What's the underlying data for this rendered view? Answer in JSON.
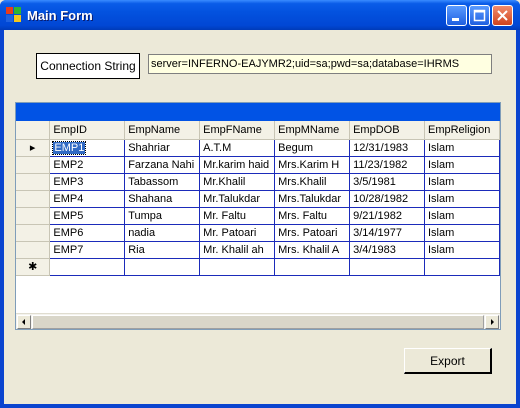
{
  "window": {
    "title": "Main Form",
    "colors": {
      "titlebar": "#0352df",
      "caption_bar": "#0153e5",
      "grid_line": "#1b2bba",
      "selection": "#316ac5"
    }
  },
  "toolbar": {
    "connection_label": "Connection String",
    "connection_value": "server=INFERNO-EAJYMR2;uid=sa;pwd=sa;database=IHRMS",
    "export_label": "Export"
  },
  "grid": {
    "columns": [
      "EmpID",
      "EmpName",
      "EmpFName",
      "EmpMName",
      "EmpDOB",
      "EmpReligion"
    ],
    "rows": [
      [
        "EMP1",
        "Shahriar",
        "A.T.M",
        "Begum",
        "12/31/1983",
        "Islam"
      ],
      [
        "EMP2",
        "Farzana Nahi",
        "Mr.karim haid",
        "Mrs.Karim H",
        "11/23/1982",
        "Islam"
      ],
      [
        "EMP3",
        "Tabassom",
        "Mr.Khalil",
        "Mrs.Khalil",
        "3/5/1981",
        "Islam"
      ],
      [
        "EMP4",
        "Shahana",
        "Mr.Talukdar",
        "Mrs.Talukdar",
        "10/28/1982",
        "Islam"
      ],
      [
        "EMP5",
        "Tumpa",
        "Mr. Faltu",
        "Mrs. Faltu",
        "9/21/1982",
        "Islam"
      ],
      [
        "EMP6",
        "nadia",
        "Mr. Patoari",
        "Mrs. Patoari",
        "3/14/1977",
        "Islam"
      ],
      [
        "EMP7",
        "Ria",
        "Mr. Khalil ah",
        "Mrs. Khalil A",
        "3/4/1983",
        "Islam"
      ]
    ],
    "current_row_marker": "▸",
    "new_row_marker": "✱",
    "selected_cell": "EMP1"
  },
  "icons": [
    "app-icon",
    "minimize-icon",
    "maximize-icon",
    "close-icon",
    "scroll-left-icon",
    "scroll-right-icon"
  ]
}
